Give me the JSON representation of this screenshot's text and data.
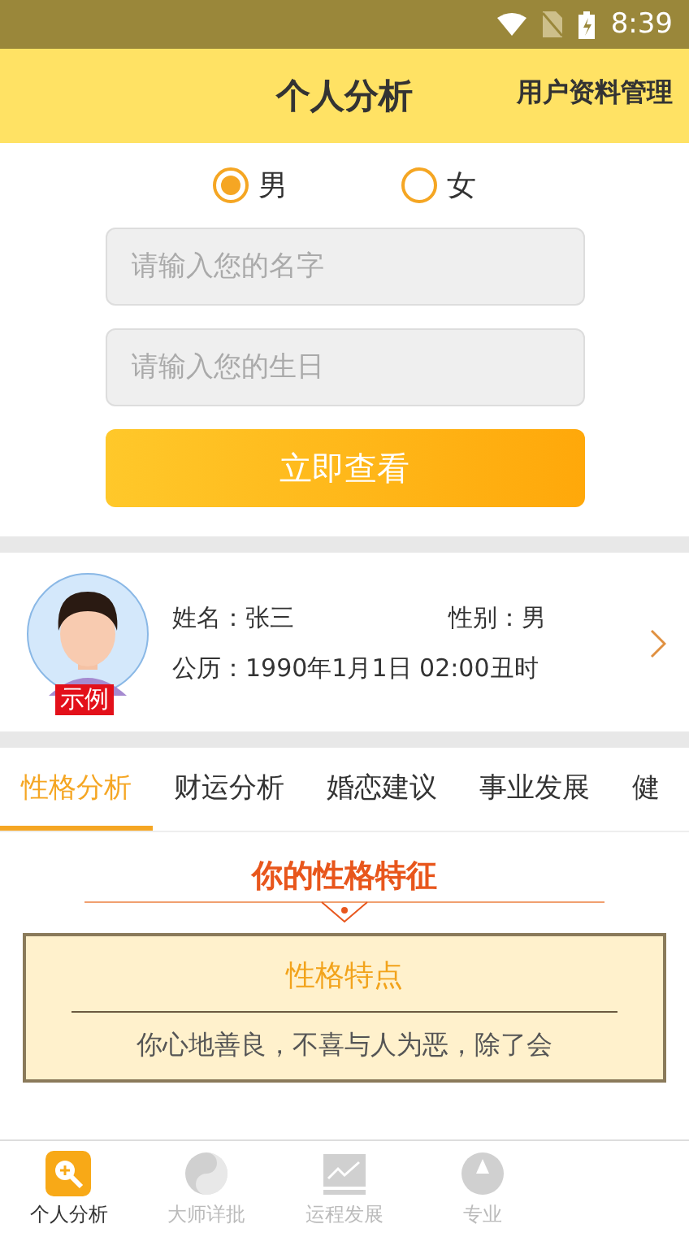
{
  "status_bar": {
    "time": "8:39"
  },
  "header": {
    "title": "个人分析",
    "action": "用户资料管理"
  },
  "gender_options": [
    {
      "label": "男",
      "selected": true
    },
    {
      "label": "女",
      "selected": false
    }
  ],
  "name_field": {
    "placeholder": "请输入您的名字"
  },
  "birthday_field": {
    "placeholder": "请输入您的生日"
  },
  "submit_button": "立即查看",
  "profile": {
    "badge": "示例",
    "name": "姓名：张三",
    "gender": "性别：男",
    "birth": "公历：1990年1月1日 02:00丑时"
  },
  "tabs": [
    {
      "label": "性格分析",
      "selected": true
    },
    {
      "label": "财运分析",
      "selected": false
    },
    {
      "label": "婚恋建议",
      "selected": false
    },
    {
      "label": "事业发展",
      "selected": false
    },
    {
      "label": "健",
      "selected": false
    }
  ],
  "section": {
    "title": "你的性格特征",
    "card_title": "性格特点",
    "text": "你心地善良，不喜与人为恶，除了会"
  },
  "bottom_nav": [
    {
      "label": "个人分析",
      "kind": "search",
      "selected": true
    },
    {
      "label": "大师详批",
      "kind": "yinyang",
      "selected": false
    },
    {
      "label": "运程发展",
      "kind": "chart",
      "selected": false
    },
    {
      "label": "专业",
      "kind": "compass",
      "selected": false
    }
  ]
}
